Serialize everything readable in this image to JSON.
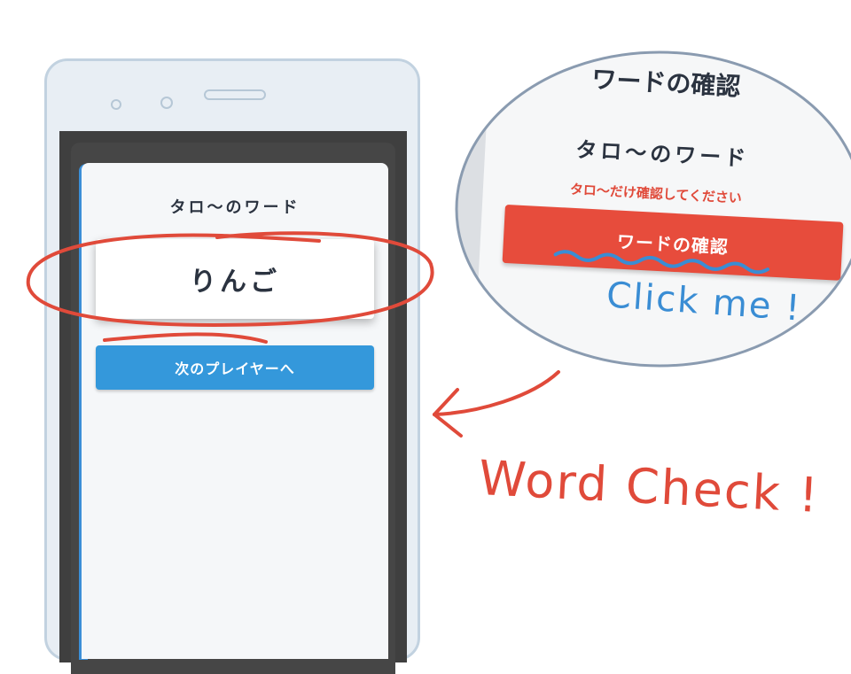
{
  "app": {
    "player_title": "タロ〜のワード",
    "word": "りんご",
    "next_button_label": "次のプレイヤーへ"
  },
  "zoom": {
    "heading": "ワードの確認",
    "player_title": "タロ〜のワード",
    "note": "タロ〜だけ確認してください",
    "confirm_button_label": "ワードの確認"
  },
  "annotations": {
    "click_me": "Click me !",
    "word_check": "Word Check !"
  },
  "colors": {
    "primary_blue": "#3498db",
    "danger_red": "#e74c3c",
    "annotation_red": "#e04a3a",
    "annotation_blue": "#3a8dd4"
  }
}
